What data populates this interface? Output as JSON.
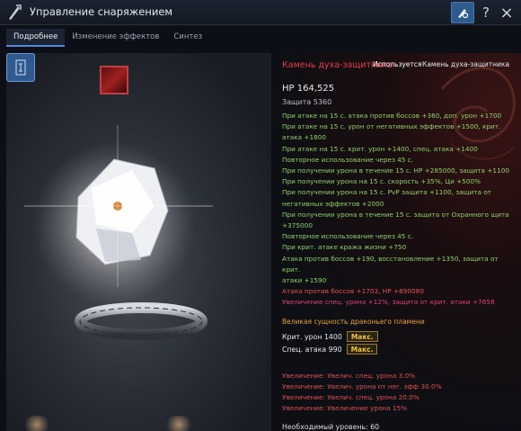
{
  "window": {
    "title": "Управление снаряжением",
    "help_label": "?",
    "close_label": "×"
  },
  "tabs": [
    {
      "label": "Подробнее",
      "active": true
    },
    {
      "label": "Изменение эффектов",
      "active": false
    },
    {
      "label": "Синтез",
      "active": false
    }
  ],
  "item": {
    "name": "Камень духа-защитника",
    "in_use_label": "Используется",
    "in_use_item": "Камень духа-защитника",
    "hp": "HP 164,525",
    "defense": "Защита 5360"
  },
  "effects": [
    {
      "text": "При атаке на 15 с. атака против боссов +360, доп. урон +1700",
      "color": "green"
    },
    {
      "text": "При атаке на 15 с. урон от негативных эффектов +1500, крит.",
      "color": "green"
    },
    {
      "text": "атака +1800",
      "color": "green"
    },
    {
      "text": "При атаке на 15 с. крит. урон +1400, спец. атака +1400",
      "color": "green"
    },
    {
      "text": "Повторное использование через 45 с.",
      "color": "green"
    },
    {
      "text": "При получении урона в течение 15 с. HP +285000, защита +1100",
      "color": "green"
    },
    {
      "text": "При получении урона на 15 с. скорость +35%, Ци +500%",
      "color": "green"
    },
    {
      "text": "При получении урона на 15 с. PvP защита +1100, защита от",
      "color": "green"
    },
    {
      "text": "негативных эффектов +2000",
      "color": "green"
    },
    {
      "text": "При получении урона в течение 15 с. защита от Охранного щита",
      "color": "green"
    },
    {
      "text": "+375000",
      "color": "green"
    },
    {
      "text": "Повторное использование через 45 с.",
      "color": "green"
    },
    {
      "text": "При крит. атаке кража жизни +750",
      "color": "green"
    },
    {
      "text": "Атака против боссов +190, восстановление +1350, защита от крит.",
      "color": "green"
    },
    {
      "text": "атаки +1590",
      "color": "green"
    },
    {
      "text": "Атака против боссов +1703, HP +890080",
      "color": "red"
    },
    {
      "text": "Увеличение спец. урона +12%, защита от крит. атаки +7658",
      "color": "pink"
    }
  ],
  "awakening": {
    "title": "Великая сущность драконьего пламени",
    "lines": [
      {
        "label": "Крит. урон 1400",
        "badge": "Макс."
      },
      {
        "label": "Спец. атака 990",
        "badge": "Макс."
      }
    ]
  },
  "bonuses": [
    "Увеличение: Увелич. спец. урона 3.0%",
    "Увеличение: Увелич. урона от нег. эфф 30.0%",
    "Увеличение: Увелич. спец. урона 20.0%",
    "Увеличение: Увеличение урона 15%"
  ],
  "requirement": "Необходимый уровень: 60",
  "colors": {
    "green": "#8ed16a",
    "red": "#e85050",
    "pink": "#e0407a",
    "accent": "#4d8be0",
    "item_name": "#e63e4a"
  }
}
